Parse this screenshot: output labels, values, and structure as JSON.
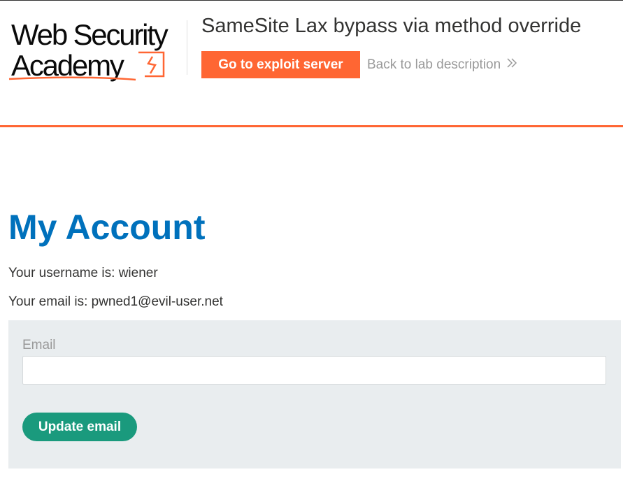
{
  "header": {
    "logo": {
      "line1": "Web Security",
      "line2": "Academy"
    },
    "lab_title": "SameSite Lax bypass via method override",
    "exploit_button": "Go to exploit server",
    "back_link": "Back to lab description",
    "back_icon": "double-chevron-right-icon",
    "accent_color": "#ff6633"
  },
  "main": {
    "title": "My Account",
    "username_line": "Your username is: wiener",
    "email_line": "Your email is: pwned1@evil-user.net",
    "form": {
      "email_label": "Email",
      "email_value": "",
      "email_placeholder": "",
      "submit_label": "Update email",
      "submit_color": "#1a9a7d"
    },
    "title_color": "#0071bc"
  }
}
